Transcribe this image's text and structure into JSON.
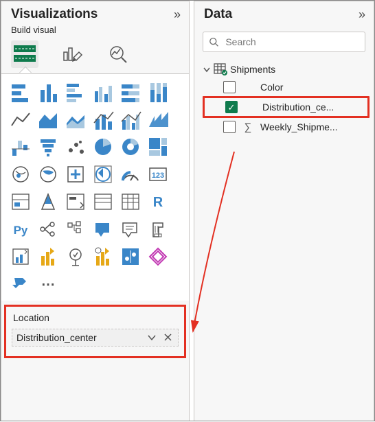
{
  "viz": {
    "title": "Visualizations",
    "subtitle": "Build visual"
  },
  "well": {
    "label": "Location",
    "item": "Distribution_center"
  },
  "data": {
    "title": "Data",
    "search_placeholder": "Search",
    "table": "Shipments",
    "fields": {
      "color": "Color",
      "distribution": "Distribution_ce...",
      "weekly": "Weekly_Shipme..."
    }
  },
  "viz_gallery_tooltips": [
    "Stacked bar chart",
    "Stacked column",
    "Clustered bar",
    "Clustered column",
    "100% stacked bar",
    "100% stacked column",
    "Line chart",
    "Area chart",
    "Stacked area",
    "Line and stacked column",
    "Line and clustered column",
    "Ribbon chart",
    "Waterfall",
    "Funnel",
    "Scatter",
    "Pie",
    "Donut",
    "Treemap",
    "Map",
    "Filled map",
    "Azure map",
    "ArcGIS map",
    "Gauge",
    "Card",
    "Multi-row card",
    "KPI",
    "Slicer",
    "Table",
    "Matrix",
    "R visual",
    "Python visual",
    "Key influencers",
    "Decomposition tree",
    "Q&A",
    "Smart narrative",
    "Paginated report",
    "Power Apps",
    "Power Automate",
    "Small multiples",
    "Metrics",
    "AppSource visual",
    "Get more visuals"
  ]
}
